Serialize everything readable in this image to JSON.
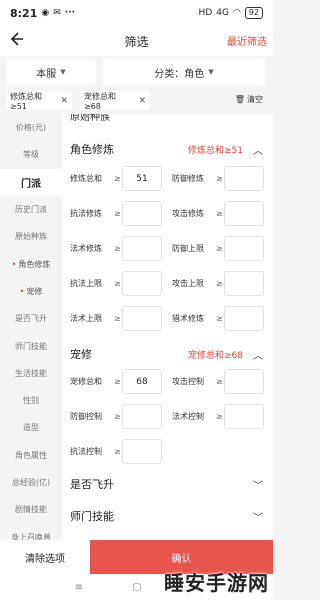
{
  "status_bar": {
    "time": "8:21",
    "battery": "92",
    "signal_text": "4G"
  },
  "header": {
    "title": "筛选",
    "recent_label": "最近筛选",
    "back_icon": "back-arrow-icon"
  },
  "filters": {
    "server": "本服",
    "category": "分类：角色"
  },
  "chips": [
    {
      "label": "修炼总和≥51"
    },
    {
      "label": "宠修总和≥68"
    }
  ],
  "clear_label": "清空",
  "sidebar": {
    "items": [
      {
        "label": "价格(元)"
      },
      {
        "label": "等级"
      },
      {
        "label": "门派"
      },
      {
        "label": "历史门派"
      },
      {
        "label": "原始种族"
      },
      {
        "label": "角色修炼"
      },
      {
        "label": "宠修"
      },
      {
        "label": "是否飞升"
      },
      {
        "label": "师门技能"
      },
      {
        "label": "生活技能"
      },
      {
        "label": "性别"
      },
      {
        "label": "造型"
      },
      {
        "label": "角色属性"
      },
      {
        "label": "总经验(亿)"
      },
      {
        "label": "剧情技能"
      },
      {
        "label": "身上召唤兽"
      }
    ]
  },
  "main": {
    "cut_section": "原始种族",
    "role_cultivation": {
      "title": "角色修炼",
      "summary": "修炼总和≥51",
      "fields": [
        {
          "label": "修炼总和",
          "sep": "≥",
          "value": "51"
        },
        {
          "label": "防御修炼",
          "sep": "≥",
          "value": ""
        },
        {
          "label": "抗法修炼",
          "sep": "≥",
          "value": ""
        },
        {
          "label": "攻击修炼",
          "sep": "≥",
          "value": ""
        },
        {
          "label": "法术修炼",
          "sep": "≥",
          "value": ""
        },
        {
          "label": "防御上限",
          "sep": "≥",
          "value": ""
        },
        {
          "label": "抗法上限",
          "sep": "≥",
          "value": ""
        },
        {
          "label": "攻击上限",
          "sep": "≥",
          "value": ""
        },
        {
          "label": "法术上限",
          "sep": "≥",
          "value": ""
        },
        {
          "label": "猎术修炼",
          "sep": "≥",
          "value": ""
        }
      ]
    },
    "pet_cultivation": {
      "title": "宠修",
      "summary": "宠修总和≥68",
      "fields": [
        {
          "label": "宠修总和",
          "sep": "≥",
          "value": "68"
        },
        {
          "label": "攻击控制",
          "sep": "≥",
          "value": ""
        },
        {
          "label": "防御控制",
          "sep": "≥",
          "value": ""
        },
        {
          "label": "法术控制",
          "sep": "≥",
          "value": ""
        },
        {
          "label": "抗法控制",
          "sep": "≥",
          "value": ""
        }
      ]
    },
    "ascension": {
      "title": "是否飞升"
    },
    "sect_skill": {
      "title": "师门技能"
    }
  },
  "bottom": {
    "reset_label": "清除选项",
    "confirm_label": "确认"
  },
  "watermark": "睡安手游网",
  "colors": {
    "accent": "#e0463a",
    "confirm": "#e8554f"
  }
}
